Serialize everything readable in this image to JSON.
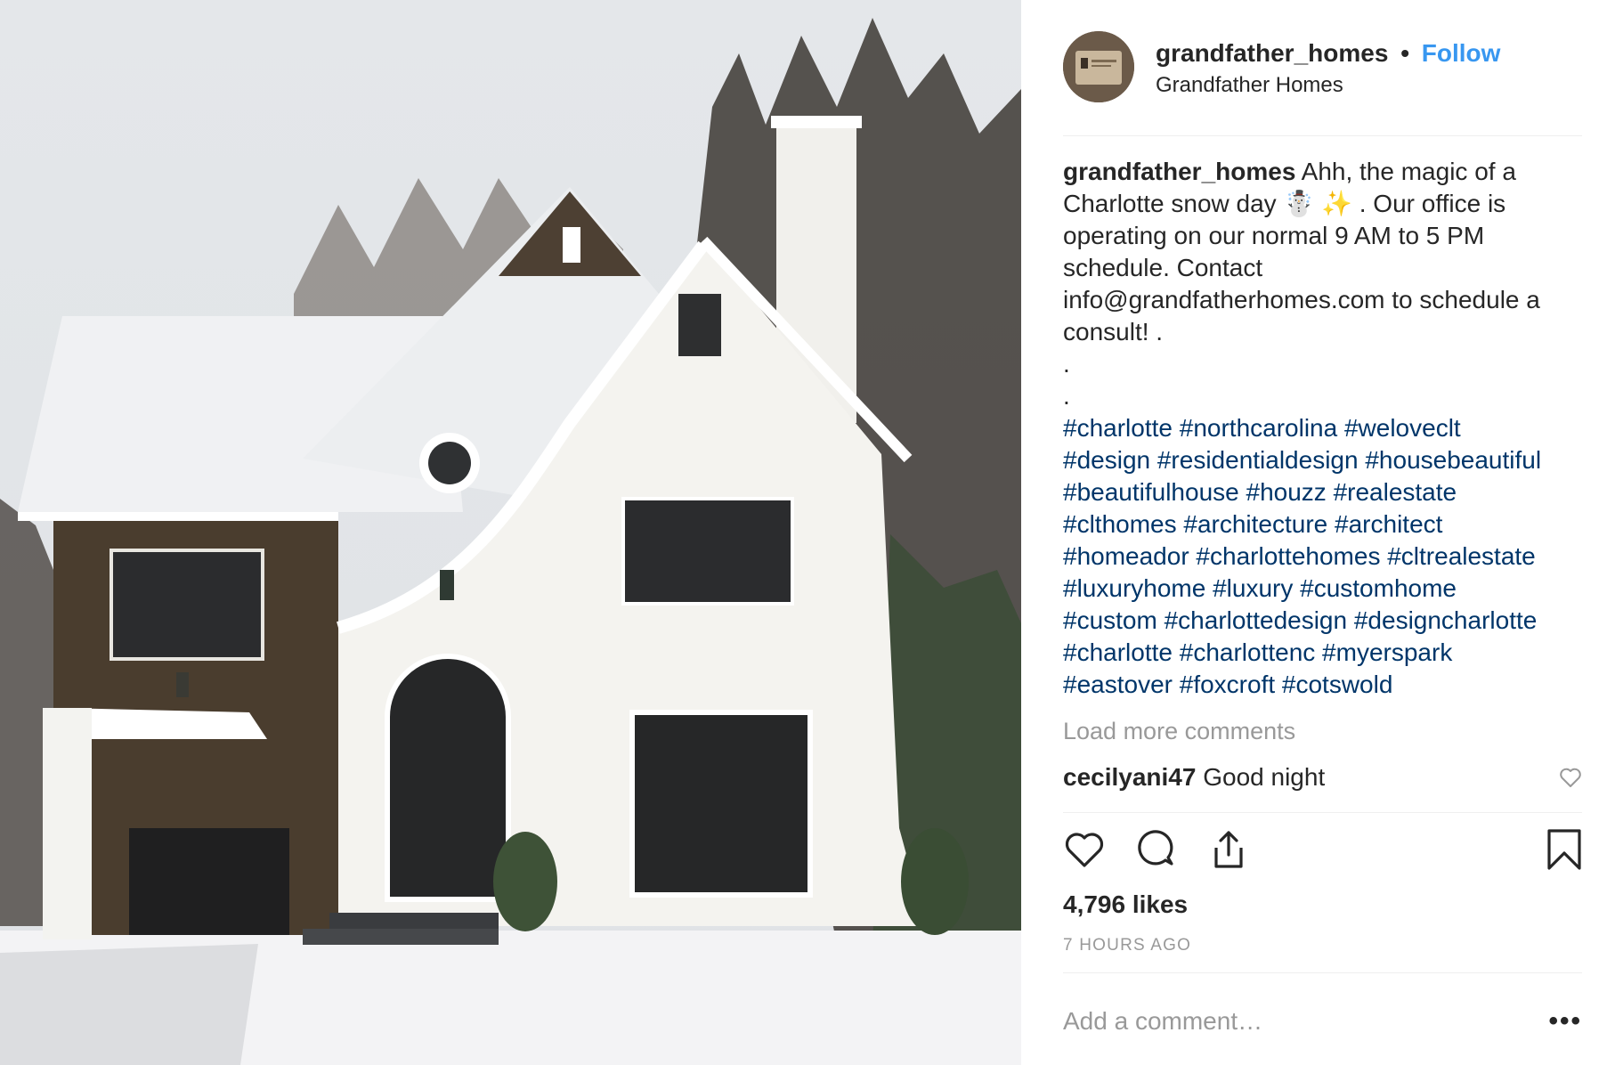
{
  "post": {
    "username": "grandfather_homes",
    "separator": "•",
    "follow_label": "Follow",
    "location": "Grandfather Homes",
    "caption_text": "Ahh, the magic of a\nCharlotte snow day ☃️ ✨ . Our office is\noperating on our normal 9 AM to 5 PM\nschedule. Contact\ninfo@grandfatherhomes.com to schedule a\nconsult! .\n.\n.",
    "hashtag_lines": [
      "#charlotte #northcarolina #weloveclt",
      "#design #residentialdesign #housebeautiful",
      "#beautifulhouse #houzz #realestate",
      "#clthomes #architecture #architect",
      "#homeador #charlottehomes #cltrealestate",
      "#luxuryhome #luxury #customhome",
      "#custom #charlottedesign #designcharlotte",
      "#charlotte #charlottenc #myerspark",
      "#eastover #foxcroft #cotswold"
    ],
    "load_more": "Load more comments",
    "comment": {
      "username": "cecilyani47",
      "text": "Good night"
    },
    "likes": "4,796 likes",
    "timestamp": "7 HOURS AGO",
    "add_comment_placeholder": "Add a comment…",
    "more_options": "•••"
  },
  "icons": {
    "like": "heart-icon",
    "comment": "speech-bubble-icon",
    "share": "share-icon",
    "save": "bookmark-icon",
    "comment_like": "small-heart-icon"
  },
  "colors": {
    "follow": "#3897f0",
    "hashtag": "#003569",
    "muted": "#999999",
    "text": "#262626"
  }
}
